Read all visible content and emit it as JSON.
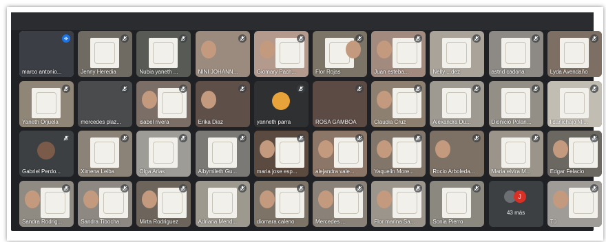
{
  "app": {
    "name": "Google Meet video grid"
  },
  "participants": [
    {
      "name": "marco antonio...",
      "speaking": true
    },
    {
      "name": "Jenny Heredia"
    },
    {
      "name": "Nubia yaneth ..."
    },
    {
      "name": "NINI JOHANN..."
    },
    {
      "name": "Giomary Pach..."
    },
    {
      "name": "Flor Rojas"
    },
    {
      "name": "Juan esteba..."
    },
    {
      "name": "Nelly ...dez"
    },
    {
      "name": "astrid cadona"
    },
    {
      "name": "Lyda Avendaño"
    },
    {
      "name": "Yaneth Orjuela"
    },
    {
      "name": "mercedes plaz..."
    },
    {
      "name": "isabel rivera"
    },
    {
      "name": "Erika Diaz"
    },
    {
      "name": "yanneth parra"
    },
    {
      "name": "ROSA GAMBOA"
    },
    {
      "name": "Claudia Cruz"
    },
    {
      "name": "Alexandra Du..."
    },
    {
      "name": "Dionicio Polan..."
    },
    {
      "name": "lidanichajo Mi..."
    },
    {
      "name": "Gabriel Perdo..."
    },
    {
      "name": "Ximena Leiba"
    },
    {
      "name": "Olga Arias"
    },
    {
      "name": "Aibymileth Gu..."
    },
    {
      "name": "maria jose esp..."
    },
    {
      "name": "alejandra vale..."
    },
    {
      "name": "Yaquelin More..."
    },
    {
      "name": "Rocio Arboleda..."
    },
    {
      "name": "Maria elvira M..."
    },
    {
      "name": "Edgar Felacio"
    },
    {
      "name": "Sandra Rodrig..."
    },
    {
      "name": "Sandra Tibocha"
    },
    {
      "name": "Mirta Rodriguez"
    },
    {
      "name": "Adriana Mend..."
    },
    {
      "name": "diomara caleno"
    },
    {
      "name": "Mercedes ..."
    },
    {
      "name": "Flor marina Sa..."
    },
    {
      "name": "Sonia Pierro"
    },
    {
      "name": ""
    },
    {
      "name": "Tú"
    }
  ],
  "more": {
    "label": "43 más",
    "avatar_letter": "J"
  },
  "colors": {
    "meet_bg": "#202124",
    "tile_bg": "#3c4043",
    "speaking": "#1a73e8"
  }
}
